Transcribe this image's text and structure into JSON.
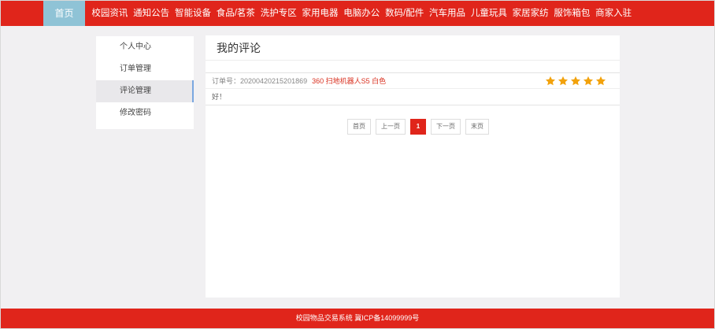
{
  "nav": {
    "home": "首页",
    "items": [
      "校园资讯",
      "通知公告",
      "智能设备",
      "食品/茗茶",
      "洗护专区",
      "家用电器",
      "电脑办公",
      "数码/配件",
      "汽车用品",
      "儿童玩具",
      "家居家纺",
      "服饰箱包",
      "商家入驻"
    ]
  },
  "sidebar": {
    "items": [
      {
        "label": "个人中心"
      },
      {
        "label": "订单管理"
      },
      {
        "label": "评论管理"
      },
      {
        "label": "修改密码"
      }
    ]
  },
  "main": {
    "title": "我的评论",
    "comments": [
      {
        "order_label": "订单号：20200420215201869",
        "product": "360 扫地机器人S5 白色",
        "rating": 5,
        "text": "好！"
      }
    ]
  },
  "pagination": {
    "first": "首页",
    "prev": "上一页",
    "current": "1",
    "next": "下一页",
    "last": "末页"
  },
  "footer": {
    "text": "校园物品交易系统 冀ICP备14099999号"
  },
  "colors": {
    "brand_red": "#e0251b",
    "home_tab": "#8fc3d6",
    "star": "#f2a20c",
    "active_indicator": "#7aa7e0"
  }
}
